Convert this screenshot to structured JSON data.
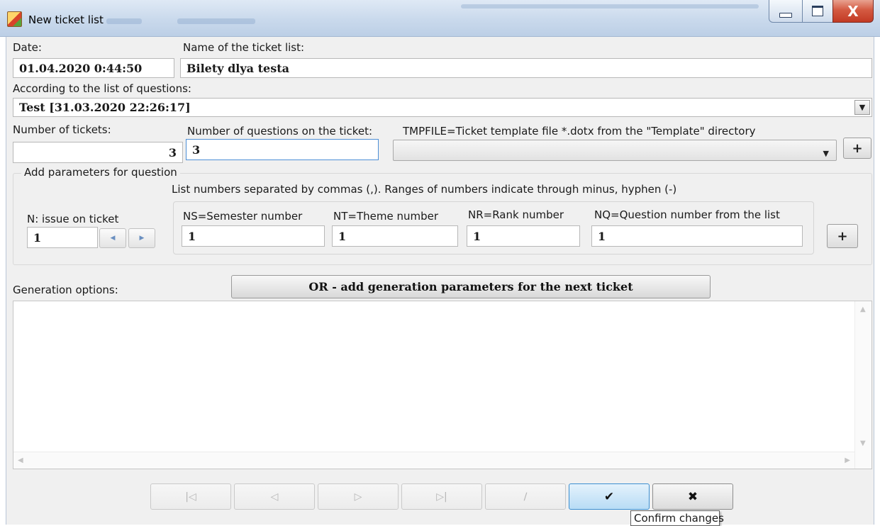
{
  "window": {
    "title": "New ticket list",
    "bg_ghost_texts": [
      "Bilety dlya testa",
      "3",
      "3"
    ]
  },
  "form": {
    "date_label": "Date:",
    "date_value": "01.04.2020 0:44:50",
    "name_label": "Name of the ticket list:",
    "name_value": "Bilety dlya testa",
    "questions_list_label": "According to the list of questions:",
    "questions_list_value": "Test [31.03.2020 22:26:17]",
    "num_tickets_label": "Number of tickets:",
    "num_tickets_value": "3",
    "num_questions_label": "Number of questions on the ticket:",
    "num_questions_value": "3",
    "template_label": "TMPFILE=Ticket template file *.dotx from the \"Template\" directory",
    "template_value": "",
    "template_add": "+"
  },
  "params": {
    "group_title": "Add parameters for question",
    "hint": "List numbers separated by commas (,). Ranges of numbers indicate through minus, hyphen (-)",
    "n_label": "N: issue on ticket",
    "n_value": "1",
    "ns_label": "NS=Semester number",
    "ns_value": "1",
    "nt_label": "NT=Theme number",
    "nt_value": "1",
    "nr_label": "NR=Rank number",
    "nr_value": "1",
    "nq_label": "NQ=Question number from the list",
    "nq_value": "1",
    "add": "+"
  },
  "generation": {
    "label": "Generation options:",
    "next_ticket_button": "OR - add generation parameters for the next ticket",
    "options_text": ""
  },
  "navigator": {
    "confirm": "✔",
    "cancel": "✖",
    "tooltip": "Confirm changes"
  },
  "colors": {
    "accent": "#3c8fd0",
    "window_bg": "#f0f0f0",
    "close_red": "#c23a24"
  }
}
